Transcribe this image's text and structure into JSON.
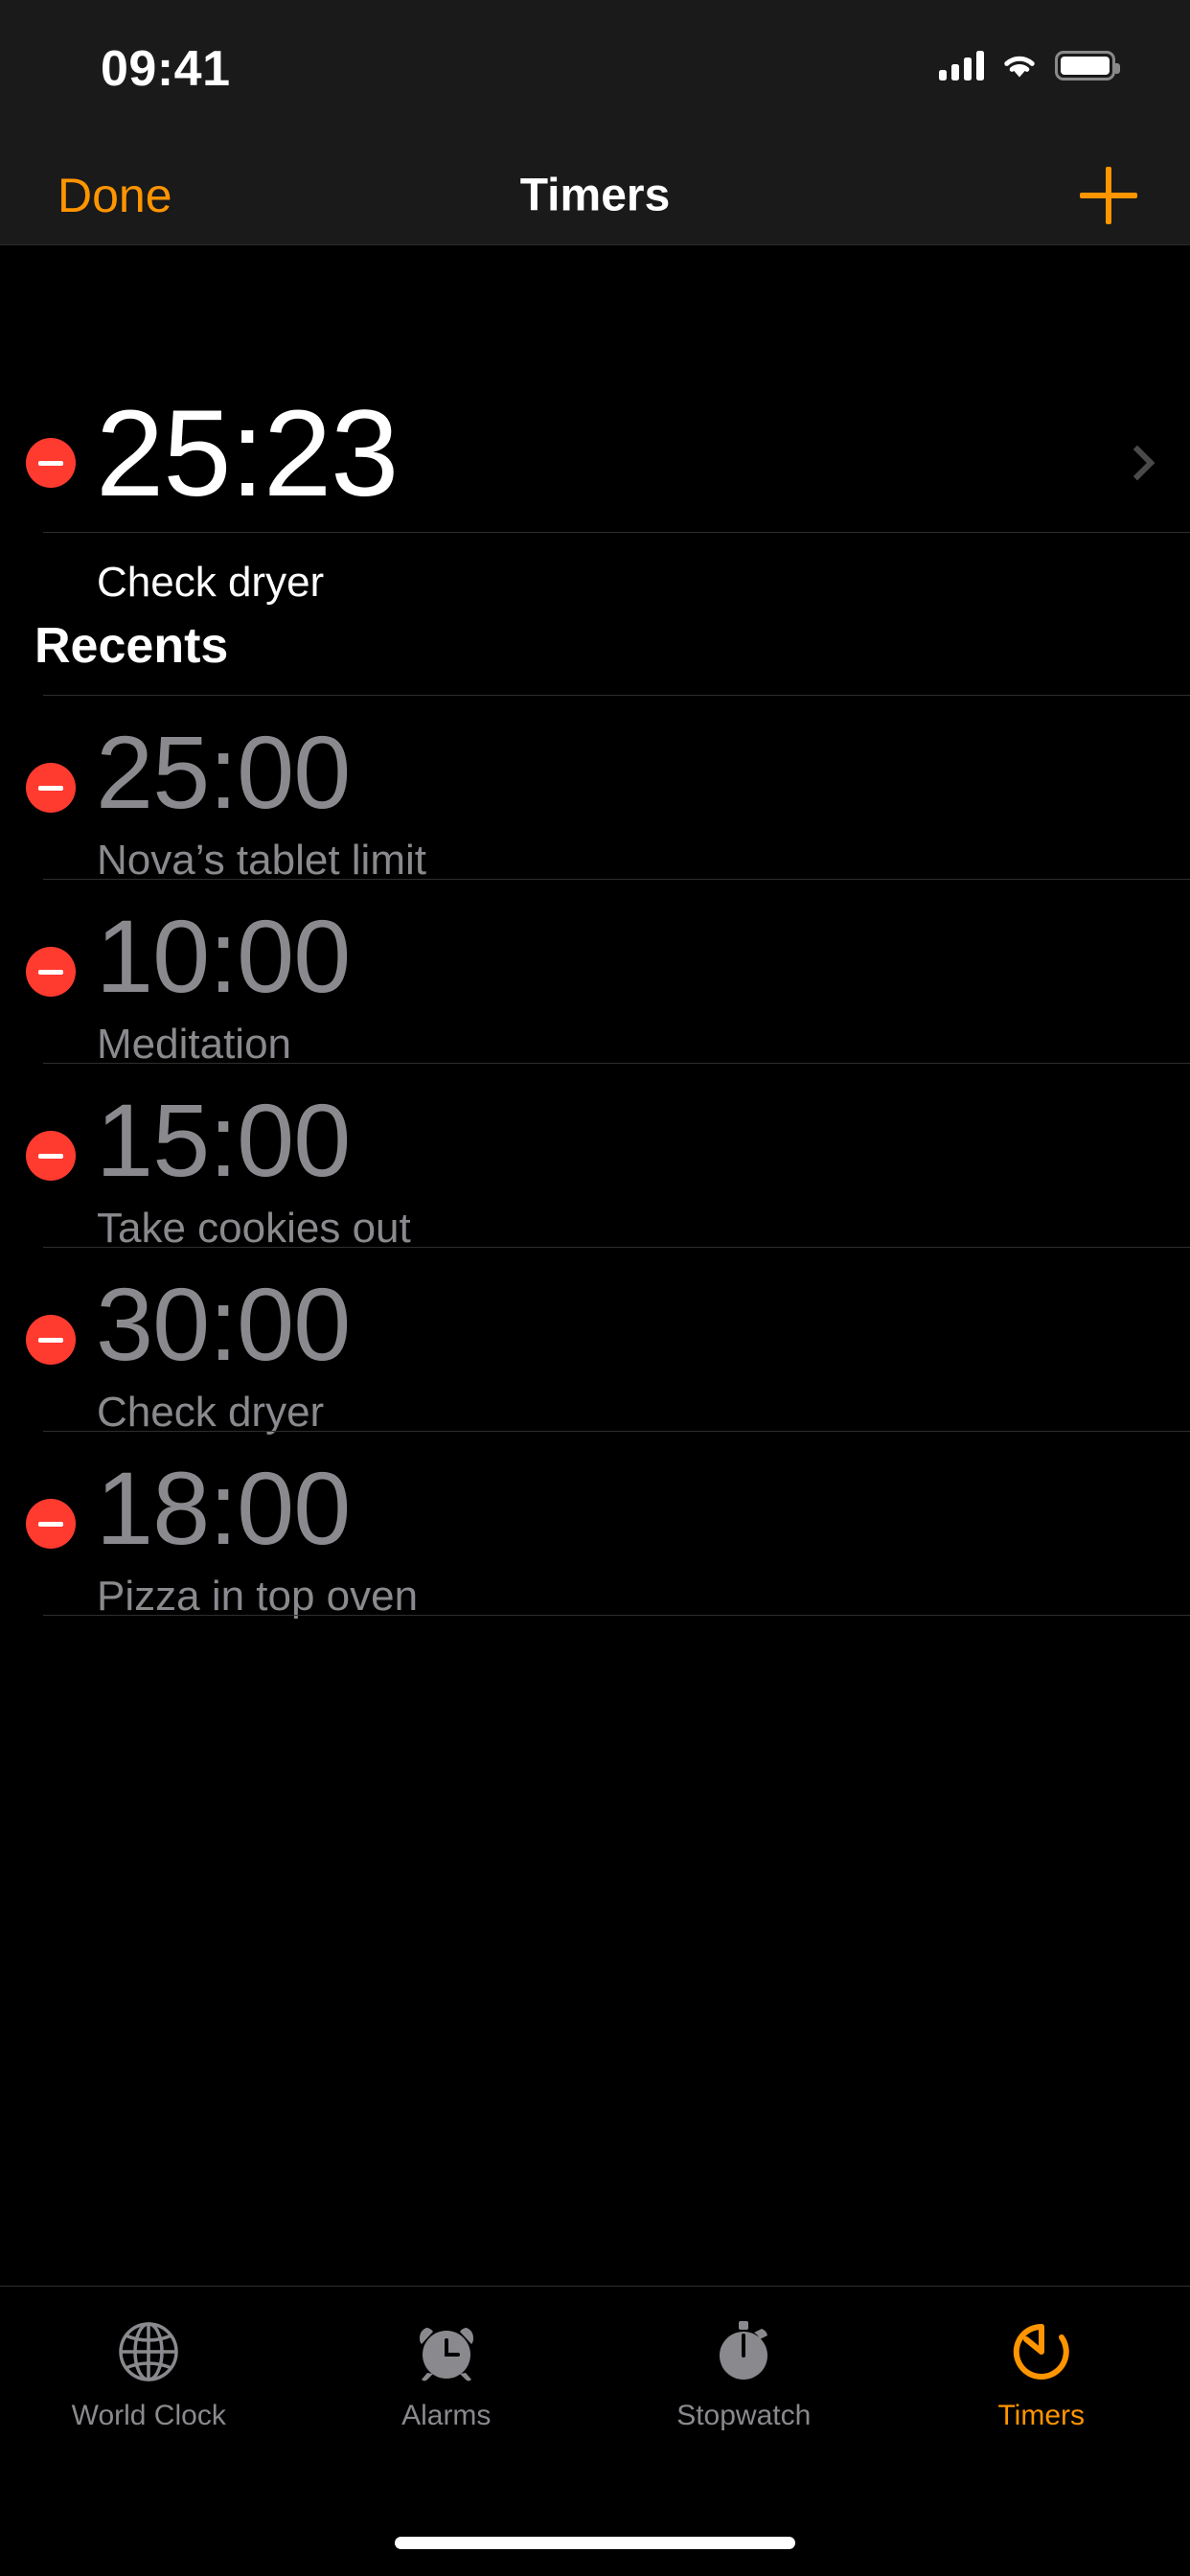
{
  "status_bar": {
    "time": "09:41",
    "signal_icon": "cellular-signal-icon",
    "wifi_icon": "wifi-icon",
    "battery_icon": "battery-full-icon"
  },
  "nav_bar": {
    "done_label": "Done",
    "title": "Timers",
    "add_icon": "plus-icon"
  },
  "active_timer": {
    "time": "25:23",
    "label": "Check dryer",
    "delete_icon": "minus-circle-icon",
    "disclosure_icon": "chevron-right-icon"
  },
  "recents": {
    "header": "Recents",
    "items": [
      {
        "time": "25:00",
        "label": "Nova’s tablet limit",
        "delete_icon": "minus-circle-icon"
      },
      {
        "time": "10:00",
        "label": "Meditation",
        "delete_icon": "minus-circle-icon"
      },
      {
        "time": "15:00",
        "label": "Take cookies out",
        "delete_icon": "minus-circle-icon"
      },
      {
        "time": "30:00",
        "label": "Check dryer",
        "delete_icon": "minus-circle-icon"
      },
      {
        "time": "18:00",
        "label": "Pizza in top oven",
        "delete_icon": "minus-circle-icon"
      }
    ]
  },
  "tab_bar": {
    "tabs": [
      {
        "label": "World Clock",
        "icon": "globe-icon",
        "active": false
      },
      {
        "label": "Alarms",
        "icon": "alarm-clock-icon",
        "active": false
      },
      {
        "label": "Stopwatch",
        "icon": "stopwatch-icon",
        "active": false
      },
      {
        "label": "Timers",
        "icon": "timer-icon",
        "active": true
      }
    ]
  },
  "colors": {
    "accent": "#FF9500",
    "delete_red": "#FF3B30",
    "secondary_text": "#8A8A8E",
    "background": "#000000"
  }
}
